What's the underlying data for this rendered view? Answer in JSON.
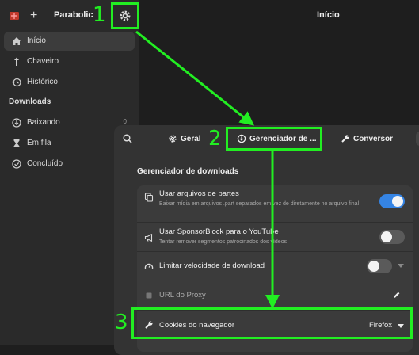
{
  "sidebar": {
    "title": "Parabolic",
    "add_label": "+",
    "nav_items": [
      {
        "label": "Início",
        "icon": "home-icon",
        "active": true
      },
      {
        "label": "Chaveiro",
        "icon": "key-icon"
      },
      {
        "label": "Histórico",
        "icon": "history-icon"
      }
    ],
    "downloads_section_title": "Downloads",
    "download_items": [
      {
        "label": "Baixando",
        "icon": "download-icon",
        "count": "0"
      },
      {
        "label": "Em fila",
        "icon": "hourglass-icon",
        "count": ""
      },
      {
        "label": "Concluído",
        "icon": "check-circle-icon",
        "count": ""
      }
    ]
  },
  "main": {
    "title": "Início"
  },
  "dialog": {
    "tabs": [
      {
        "label": "Geral",
        "icon": "gear-icon"
      },
      {
        "label": "Gerenciador de ...",
        "icon": "download-circle-icon"
      },
      {
        "label": "Conversor",
        "icon": "wrench-icon"
      }
    ],
    "section_title": "Gerenciador de downloads",
    "rows": [
      {
        "title": "Usar arquivos de partes",
        "subtitle": "Baixar mídia em arquivos .part separados em vez de diretamente no arquivo final",
        "icon": "copy-icon",
        "switch": "on"
      },
      {
        "title": "Usar SponsorBlock para o YouTube",
        "subtitle": "Tentar remover segmentos patrocinados dos vídeos",
        "icon": "megaphone-icon",
        "switch": "off"
      },
      {
        "title": "Limitar velocidade de download",
        "subtitle": "",
        "icon": "speedometer-icon",
        "switch": "off"
      },
      {
        "title": "URL do Proxy",
        "subtitle": "",
        "icon": "proxy-icon"
      },
      {
        "title": "Cookies do navegador",
        "subtitle": "",
        "icon": "wrench-icon",
        "value": "Firefox"
      }
    ]
  },
  "annotations": {
    "step1": "1",
    "step2": "2",
    "step3": "3"
  },
  "colors": {
    "highlight": "#22ee22",
    "accent": "#3584e4",
    "sidebar_bg": "#2a2a2a",
    "main_bg": "#1e1e1e",
    "dialog_bg": "#333333"
  }
}
